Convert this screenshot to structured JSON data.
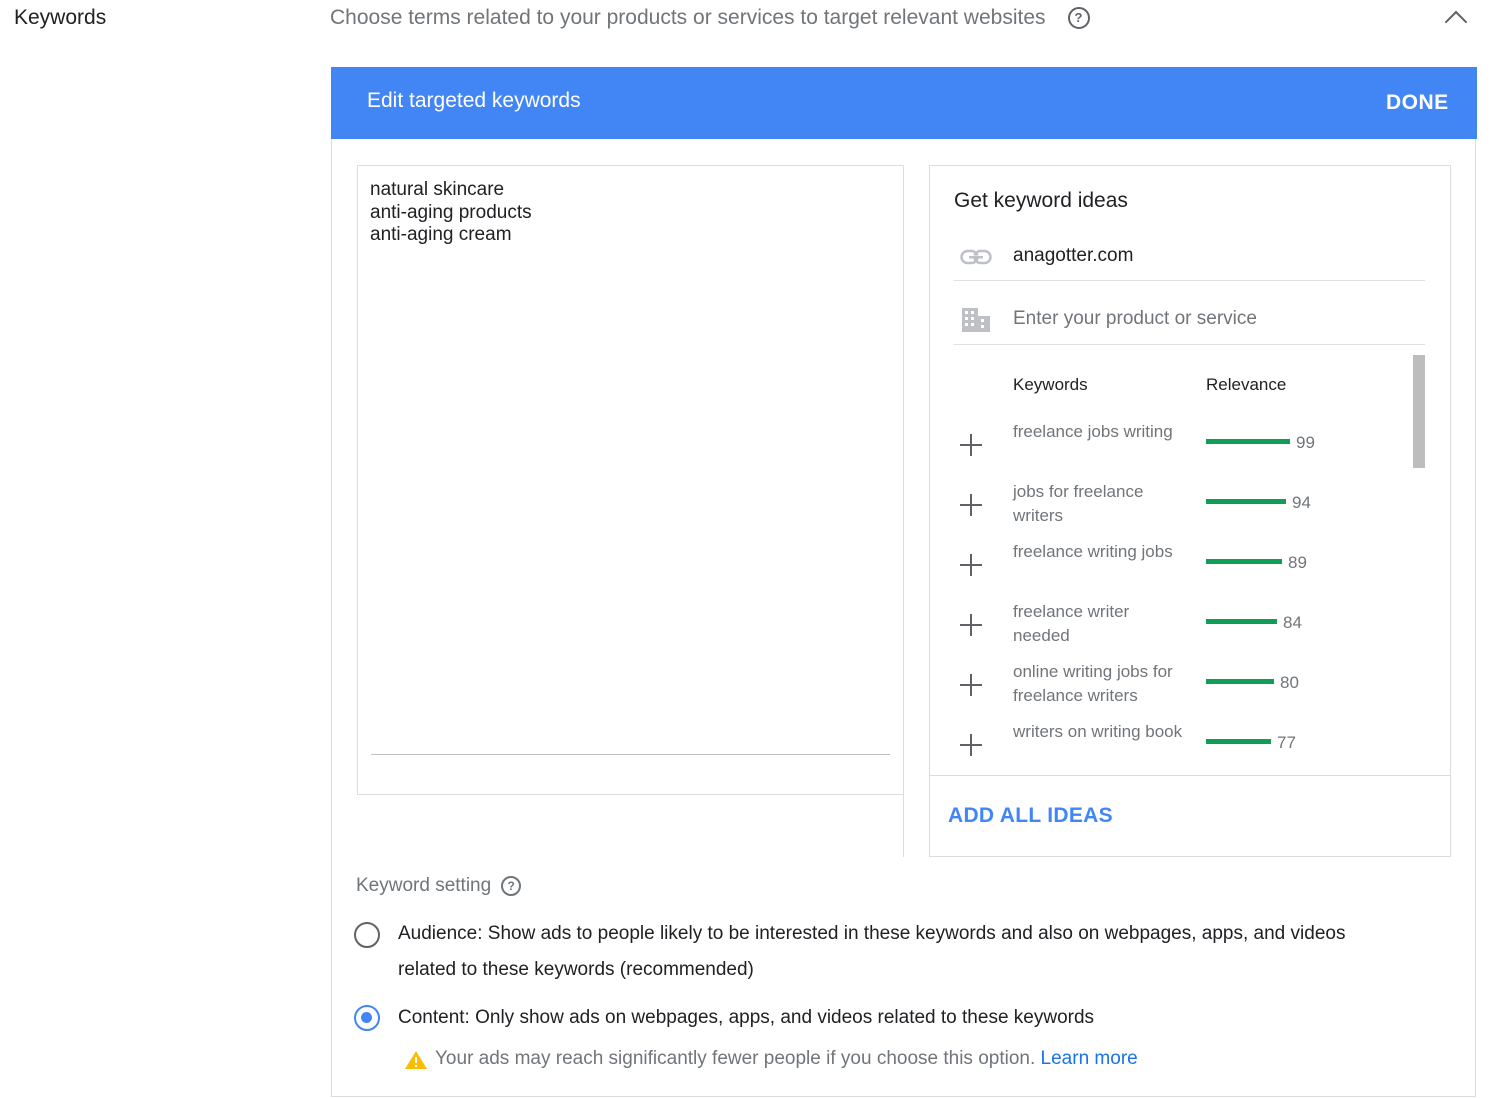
{
  "section": {
    "label": "Keywords",
    "description": "Choose terms related to your products or services to target relevant websites"
  },
  "panel": {
    "title": "Edit targeted keywords",
    "done_label": "DONE"
  },
  "keywords_textarea": {
    "value": "natural skincare\nanti-aging products\nanti-aging cream"
  },
  "ideas": {
    "title": "Get keyword ideas",
    "website": "anagotter.com",
    "product_placeholder": "Enter your product or service",
    "col_keywords": "Keywords",
    "col_relevance": "Relevance",
    "items": [
      {
        "keyword": "freelance jobs writing",
        "relevance": 99
      },
      {
        "keyword": "jobs for freelance writers",
        "relevance": 94
      },
      {
        "keyword": "freelance writing jobs",
        "relevance": 89
      },
      {
        "keyword": "freelance writer needed",
        "relevance": 84
      },
      {
        "keyword": "online writing jobs for freelance writers",
        "relevance": 80
      },
      {
        "keyword": "writers on writing book",
        "relevance": 77
      }
    ],
    "add_all_label": "ADD ALL IDEAS",
    "relevance_color": "#0f9d58"
  },
  "keyword_setting": {
    "label": "Keyword setting",
    "audience_text": "Audience: Show ads to people likely to be interested in these keywords and also on webpages, apps, and videos related to these keywords (recommended)",
    "content_text": "Content: Only show ads on webpages, apps, and videos related to these keywords",
    "selected": "content",
    "warning_text": "Your ads may reach significantly fewer people if you choose this option.",
    "learn_more": "Learn more"
  },
  "colors": {
    "accent": "#4285f4",
    "link": "#1a73e8",
    "warning": "#fbbc04"
  }
}
